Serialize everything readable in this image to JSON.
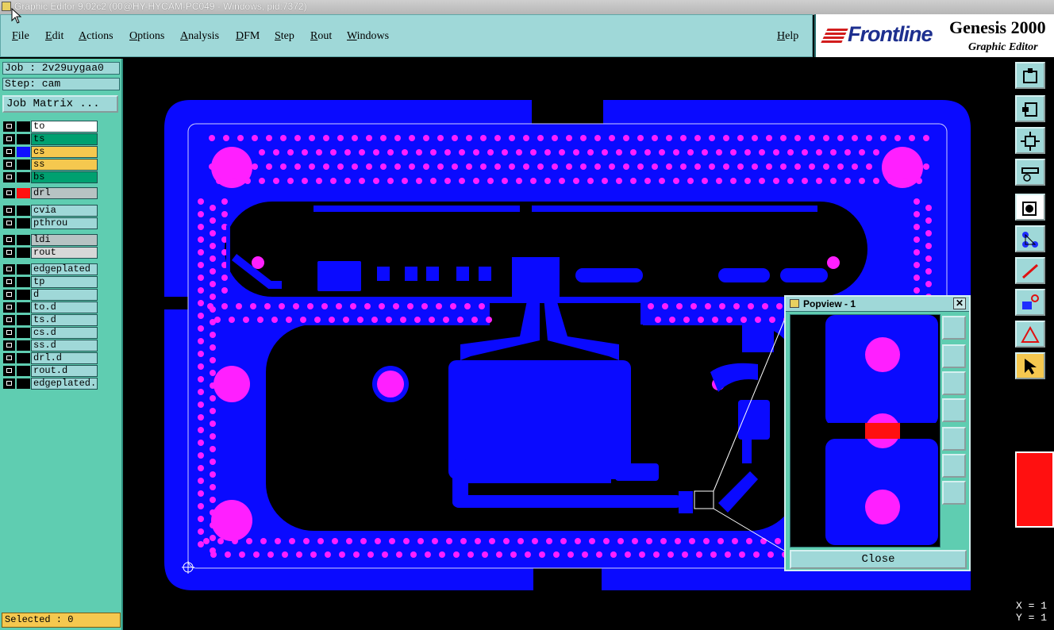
{
  "window": {
    "title": "Graphic Editor 9.02c2 (00@HY-HYCAM-PC049 - Windows, pid:7372)"
  },
  "menu": {
    "items": [
      "File",
      "Edit",
      "Actions",
      "Options",
      "Analysis",
      "DFM",
      "Step",
      "Rout",
      "Windows"
    ],
    "help": "Help"
  },
  "brand": {
    "logo": "Frontline",
    "product": "Genesis 2000",
    "subtitle": "Graphic Editor"
  },
  "job": {
    "job_text": "Job : 2v29uygaa0",
    "step_text": "Step: cam",
    "matrix_button": "Job Matrix ..."
  },
  "layers": [
    {
      "name": "to",
      "name_bg": "#ffffff",
      "swatch": "#000000"
    },
    {
      "name": "ts",
      "name_bg": "#00a070",
      "swatch": "#000000"
    },
    {
      "name": "cs",
      "name_bg": "#f5c84f",
      "swatch": "#1010ff",
      "active": true
    },
    {
      "name": "ss",
      "name_bg": "#f5c84f",
      "swatch": "#000000"
    },
    {
      "name": "bs",
      "name_bg": "#00a070",
      "swatch": "#000000"
    },
    {
      "name": "drl",
      "name_bg": "#b7c3c3",
      "swatch": "#ff1010"
    },
    {
      "name": "cvia",
      "name_bg": "#9fd8d8",
      "swatch": "#000000"
    },
    {
      "name": "pthrou",
      "name_bg": "#9fd8d8",
      "swatch": "#000000"
    },
    {
      "name": "ldi",
      "name_bg": "#b7c3c3",
      "swatch": "#000000"
    },
    {
      "name": "rout",
      "name_bg": "#d8d8d8",
      "swatch": "#000000"
    },
    {
      "name": "edgeplated",
      "name_bg": "#9fd8d8",
      "swatch": "#000000"
    },
    {
      "name": "tp",
      "name_bg": "#9fd8d8",
      "swatch": "#000000"
    },
    {
      "name": "d",
      "name_bg": "#9fd8d8",
      "swatch": "#000000"
    },
    {
      "name": "to.d",
      "name_bg": "#9fd8d8",
      "swatch": "#000000"
    },
    {
      "name": "ts.d",
      "name_bg": "#9fd8d8",
      "swatch": "#000000"
    },
    {
      "name": "cs.d",
      "name_bg": "#9fd8d8",
      "swatch": "#000000"
    },
    {
      "name": "ss.d",
      "name_bg": "#9fd8d8",
      "swatch": "#000000"
    },
    {
      "name": "drl.d",
      "name_bg": "#9fd8d8",
      "swatch": "#000000"
    },
    {
      "name": "rout.d",
      "name_bg": "#9fd8d8",
      "swatch": "#000000"
    },
    {
      "name": "edgeplated.c",
      "name_bg": "#9fd8d8",
      "swatch": "#000000"
    }
  ],
  "status": {
    "selected_text": "Selected : 0"
  },
  "popview": {
    "title": "Popview - 1",
    "close_label": "Close",
    "close_x": "✕"
  },
  "coords": {
    "x_text": "X = 1",
    "y_text": "Y = 1"
  },
  "colors": {
    "copper": "#0a0aff",
    "pad": "#ff1fff",
    "drill": "#ff1010",
    "panel_bg": "#5fcdb1",
    "menu_bg": "#9fd8d8"
  },
  "right_tools": [
    "move-icon",
    "pan-left-icon",
    "fit-icon",
    "measure-icon",
    "select-pad-icon",
    "net-icon",
    "line-icon",
    "snap-icon",
    "triangle-icon",
    "pointer-icon"
  ]
}
